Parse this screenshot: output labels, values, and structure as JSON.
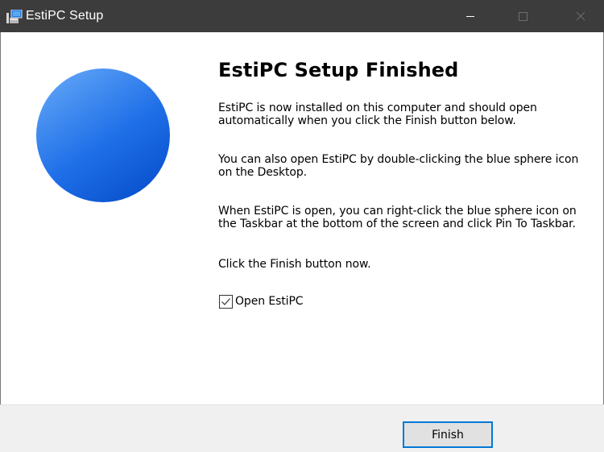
{
  "window": {
    "title": "EstiPC Setup",
    "icon": "setup-installer-icon",
    "controls": {
      "minimize_icon": "minimize-icon",
      "maximize_icon": "maximize-icon",
      "close_icon": "close-icon"
    },
    "titlebar_color": "#3c3c3c"
  },
  "graphic": {
    "icon": "blue-sphere-icon",
    "colors": [
      "#5aa0f5",
      "#1f6fe8",
      "#0a52cf"
    ]
  },
  "content": {
    "heading": "EstiPC Setup Finished",
    "paragraphs": [
      "EstiPC is now installed on this computer and should open automatically when you click the Finish button below.",
      "You can also open EstiPC by double-clicking the blue sphere icon on the Desktop.",
      "When EstiPC is open, you can right-click the blue sphere icon on the Taskbar at the bottom of the screen and click Pin To Taskbar.",
      "Click the Finish button now."
    ],
    "open_checkbox": {
      "label": "Open EstiPC",
      "checked": true
    }
  },
  "footer": {
    "finish_label": "Finish",
    "accent": "#0078d7"
  }
}
